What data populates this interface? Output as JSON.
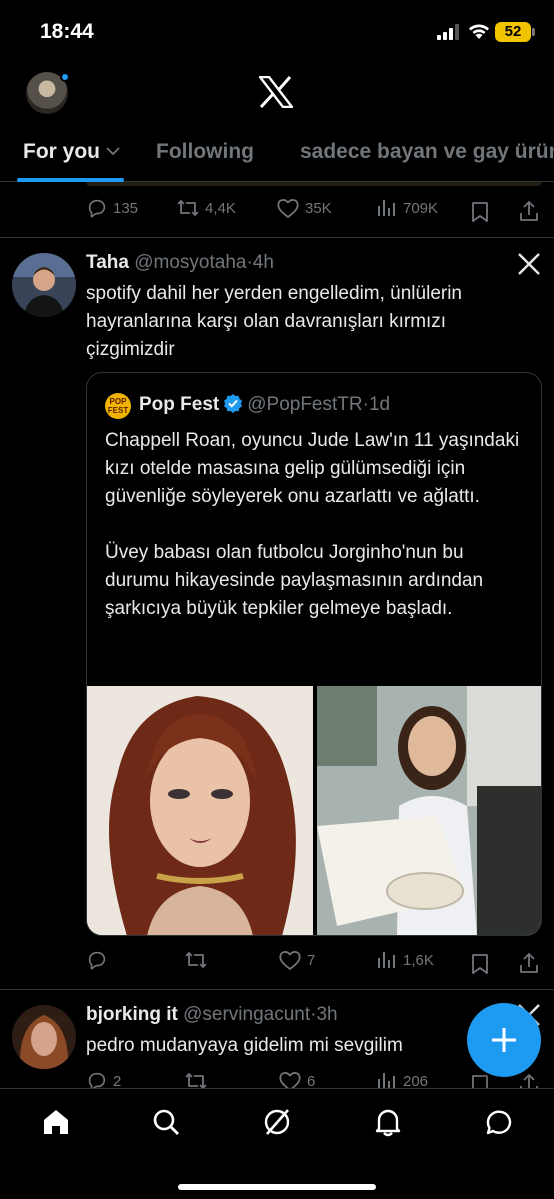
{
  "status_bar": {
    "time": "18:44",
    "battery": "52"
  },
  "tabs": {
    "for_you": "For you",
    "following": "Following",
    "custom": "sadece bayan ve gay ürün"
  },
  "prev_tweet": {
    "replies": "135",
    "reposts": "4,4K",
    "likes": "35K",
    "views": "709K"
  },
  "tweet1": {
    "name": "Taha",
    "handle": "@mosyotaha",
    "time": "4h",
    "text": "spotify dahil her yerden engelledim, ünlülerin hayranlarına karşı olan davranışları kırmızı çizgimizdir",
    "replies": "",
    "reposts": "",
    "likes": "7",
    "views": "1,6K"
  },
  "quote": {
    "logo_text": "POP FEST",
    "name": "Pop Fest",
    "handle": "@PopFestTR",
    "time": "1d",
    "para1": "Chappell Roan, oyuncu Jude Law'ın 11 yaşındaki kızı otelde masasına gelip gülümsediği için güvenliğe söyleyerek onu azarlattı ve ağlattı.",
    "para2": "Üvey babası olan futbolcu Jorginho'nun bu durumu hikayesinde paylaşmasının ardından şarkıcıya büyük tepkiler gelmeye başladı."
  },
  "tweet2": {
    "name": "bjorking it",
    "handle": "@servingacunt",
    "time": "3h",
    "text": "pedro mudanyaya gidelim mi sevgilim",
    "replies": "2",
    "likes": "6",
    "views": "206"
  },
  "separator": "·"
}
